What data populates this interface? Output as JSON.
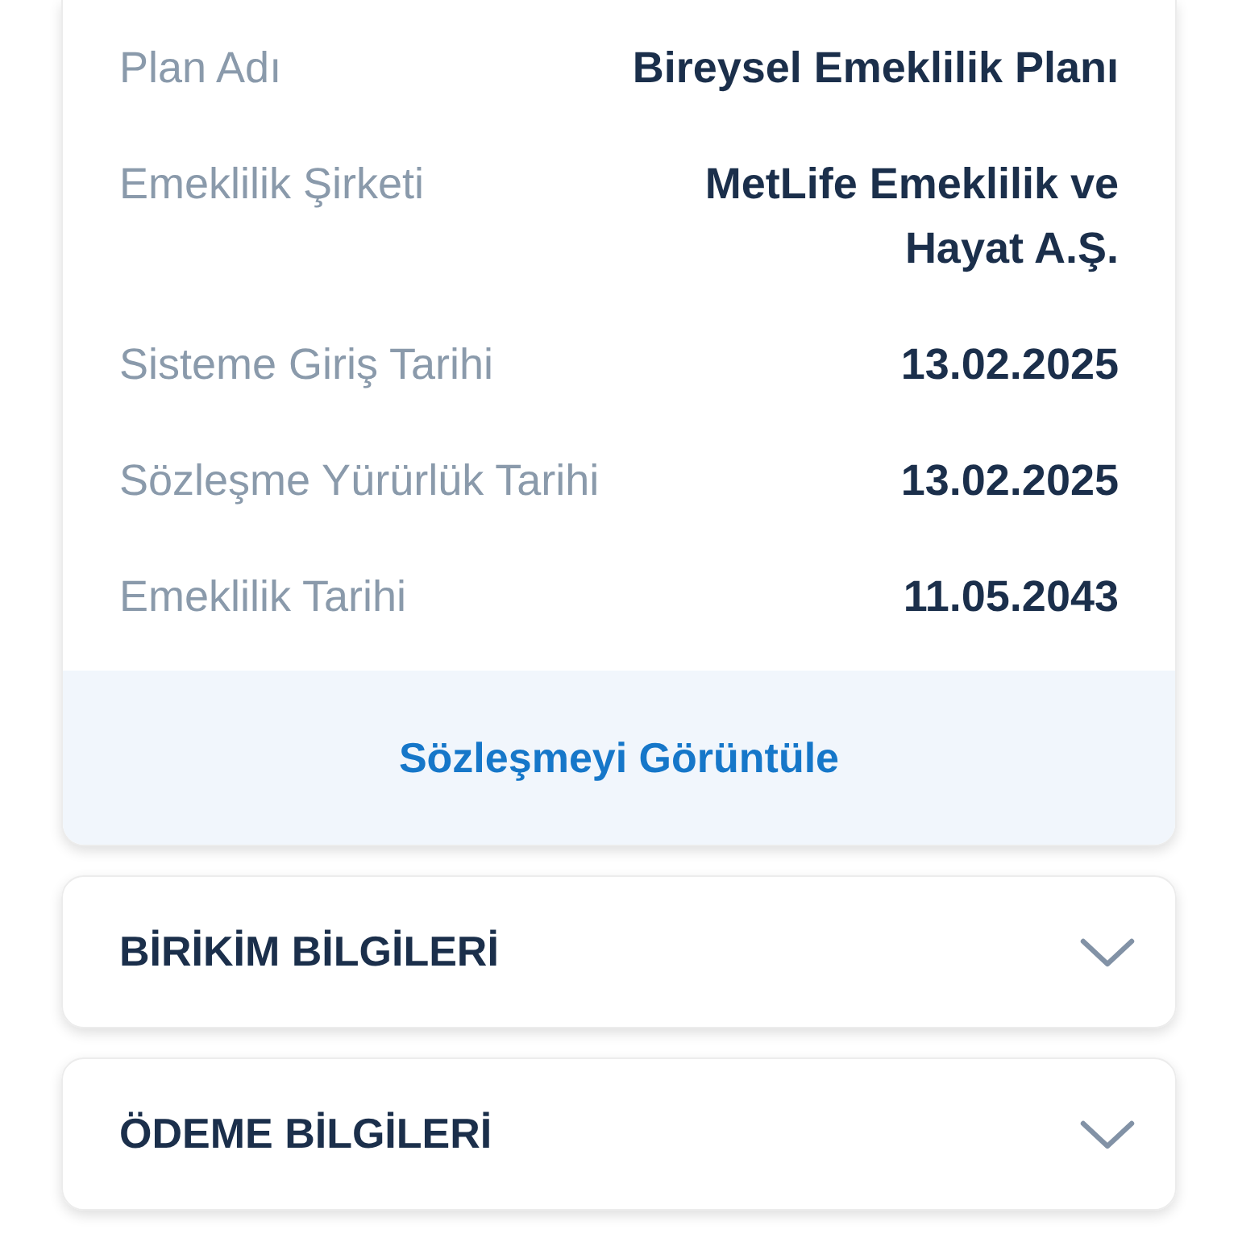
{
  "details": [
    {
      "label": "Plan Adı",
      "value": "Bireysel Emeklilik Planı"
    },
    {
      "label": "Emeklilik Şirketi",
      "value": "MetLife Emeklilik ve Hayat A.Ş."
    },
    {
      "label": "Sisteme Giriş Tarihi",
      "value": "13.02.2025"
    },
    {
      "label": "Sözleşme Yürürlük Tarihi",
      "value": "13.02.2025"
    },
    {
      "label": "Emeklilik Tarihi",
      "value": "11.05.2043"
    }
  ],
  "view_contract_button": "Sözleşmeyi Görüntüle",
  "sections": [
    {
      "title": "BİRİKİM BİLGİLERİ",
      "expanded": false
    },
    {
      "title": "ÖDEME BİLGİLERİ",
      "expanded": false
    }
  ]
}
